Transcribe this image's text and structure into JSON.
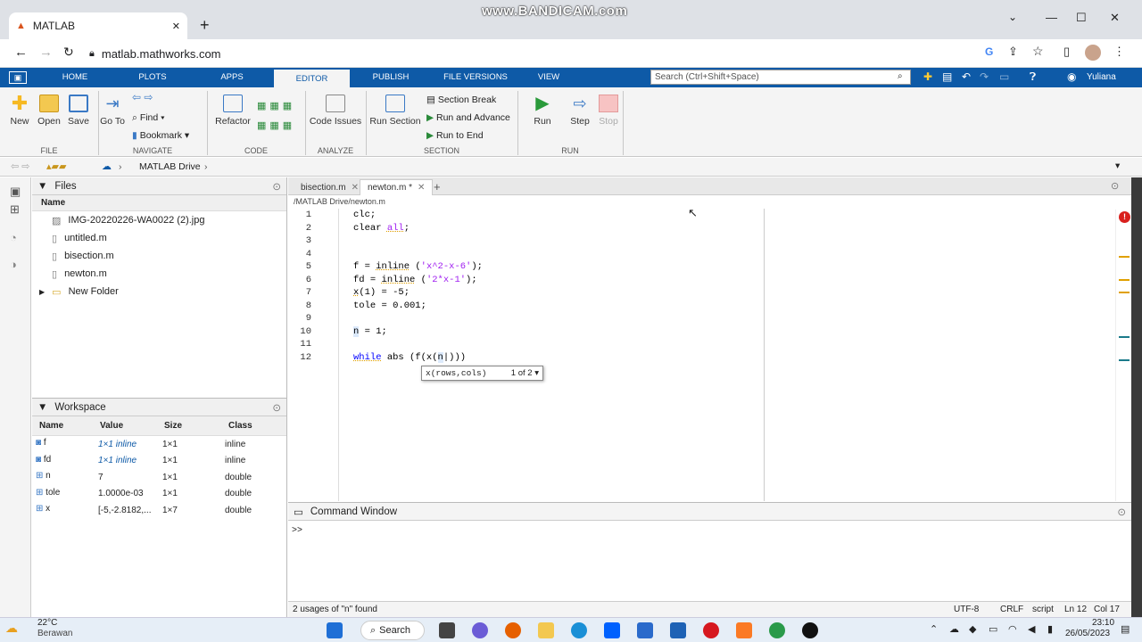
{
  "watermark": "www.BANDICAM.com",
  "browser": {
    "tab_title": "MATLAB",
    "url": "matlab.mathworks.com"
  },
  "matlab_tabs": [
    "HOME",
    "PLOTS",
    "APPS",
    "EDITOR",
    "PUBLISH",
    "FILE VERSIONS",
    "VIEW"
  ],
  "search_placeholder": "Search (Ctrl+Shift+Space)",
  "user": "Yuliana",
  "toolstrip": {
    "new": "New",
    "open": "Open",
    "save": "Save",
    "file_section": "FILE",
    "goto": "Go To",
    "find": "Find",
    "bookmark": "Bookmark",
    "navigate_section": "NAVIGATE",
    "refactor": "Refactor",
    "code_section": "CODE",
    "code_issues": "Code Issues",
    "analyze_section": "ANALYZE",
    "run_section": "Run Section",
    "section_break": "Section Break",
    "run_and_advance": "Run and Advance",
    "run_to_end": "Run to End",
    "section_section": "SECTION",
    "run": "Run",
    "step": "Step",
    "stop": "Stop",
    "run_group": "RUN"
  },
  "path": "MATLAB Drive",
  "files_panel": {
    "title": "Files",
    "name_col": "Name",
    "items": [
      "IMG-20220226-WA0022 (2).jpg",
      "untitled.m",
      "bisection.m",
      "newton.m",
      "New Folder"
    ]
  },
  "workspace": {
    "title": "Workspace",
    "cols": [
      "Name",
      "Value",
      "Size",
      "Class"
    ],
    "rows": [
      {
        "name": "f",
        "value": "1×1 inline",
        "size": "1×1",
        "class": "inline"
      },
      {
        "name": "fd",
        "value": "1×1 inline",
        "size": "1×1",
        "class": "inline"
      },
      {
        "name": "n",
        "value": "7",
        "size": "1×1",
        "class": "double"
      },
      {
        "name": "tole",
        "value": "1.0000e-03",
        "size": "1×1",
        "class": "double"
      },
      {
        "name": "x",
        "value": "[-5,-2.8182,...",
        "size": "1×7",
        "class": "double"
      }
    ]
  },
  "editor": {
    "tabs": [
      "bisection.m",
      "newton.m *"
    ],
    "file_path": "/MATLAB Drive/newton.m",
    "line_numbers": [
      "1",
      "2",
      "3",
      "4",
      "5",
      "6",
      "7",
      "8",
      "9",
      "10",
      "11",
      "12"
    ],
    "tooltip": "x(rows,cols)",
    "tooltip_count": "1 of 2"
  },
  "command_window": {
    "title": "Command Window",
    "prompt": ">>"
  },
  "status": {
    "message": "2 usages of \"n\" found",
    "encoding": "UTF-8",
    "eol": "CRLF",
    "mode": "script",
    "ln": "Ln 12",
    "col": "Col 17"
  },
  "taskbar": {
    "temp": "22°C",
    "weather": "Berawan",
    "search": "Search",
    "time": "23:10",
    "date": "26/05/2023"
  }
}
